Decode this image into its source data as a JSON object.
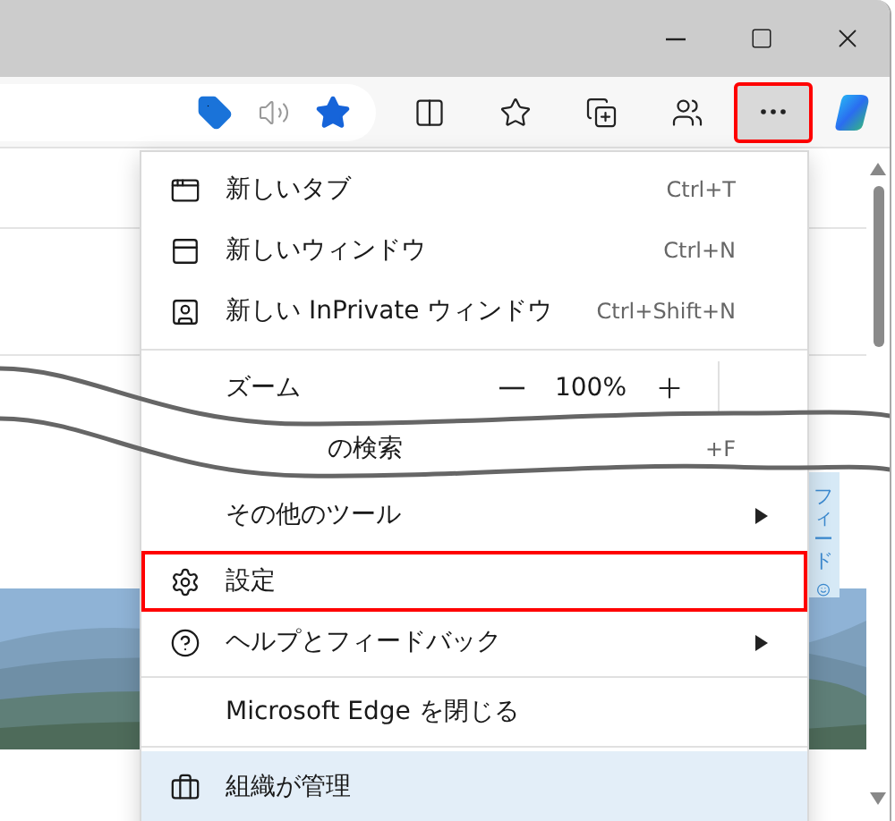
{
  "toolbar": {
    "more_button": {
      "highlighted": true
    }
  },
  "menu": {
    "items": [
      {
        "kind": "item",
        "label": "新しいタブ",
        "shortcut": "Ctrl+T",
        "submenu": false,
        "highlighted": false
      },
      {
        "kind": "item",
        "label": "新しいウィンドウ",
        "shortcut": "Ctrl+N",
        "submenu": false,
        "highlighted": false
      },
      {
        "kind": "item",
        "label": "新しい InPrivate ウィンドウ",
        "shortcut": "Ctrl+Shift+N",
        "submenu": false,
        "highlighted": false
      },
      {
        "kind": "divider"
      },
      {
        "kind": "zoom",
        "label": "ズーム",
        "value": "100%"
      },
      {
        "kind": "partial",
        "label": "の検索",
        "shortcut": "+F"
      },
      {
        "kind": "item",
        "label": "その他のツール",
        "submenu": true,
        "highlighted": false
      },
      {
        "kind": "item",
        "label": "設定",
        "submenu": false,
        "highlighted": true
      },
      {
        "kind": "item",
        "label": "ヘルプとフィードバック",
        "submenu": true,
        "highlighted": false
      },
      {
        "kind": "divider"
      },
      {
        "kind": "item",
        "label": "Microsoft Edge を閉じる",
        "submenu": false,
        "highlighted": false
      },
      {
        "kind": "divider"
      },
      {
        "kind": "managed",
        "label": "組織が管理"
      }
    ]
  },
  "feedback_tab": {
    "label": "フィード"
  }
}
